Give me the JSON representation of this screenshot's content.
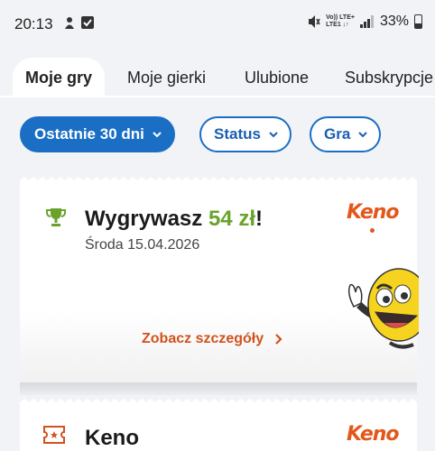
{
  "status_bar": {
    "time": "20:13",
    "network_top": "Vo)) LTE+",
    "network_bottom": "LTE1 ↓↑",
    "battery": "33%"
  },
  "tabs": [
    {
      "label": "Moje gry",
      "active": true
    },
    {
      "label": "Moje gierki",
      "active": false
    },
    {
      "label": "Ulubione",
      "active": false
    },
    {
      "label": "Subskrypcje",
      "active": false
    }
  ],
  "filters": {
    "period": "Ostatnie 30 dni",
    "status": "Status",
    "game": "Gra"
  },
  "cards": [
    {
      "title_prefix": "Wygrywasz ",
      "amount": "54 zł",
      "title_suffix": "!",
      "date": "Środa 15.04.2026",
      "logo": "Keno",
      "details_label": "Zobacz szczegóły"
    },
    {
      "title": "Keno",
      "logo": "Keno"
    }
  ],
  "colors": {
    "accent_blue": "#1a6fc4",
    "win_green": "#6aa329",
    "keno_orange": "#e2581c"
  }
}
